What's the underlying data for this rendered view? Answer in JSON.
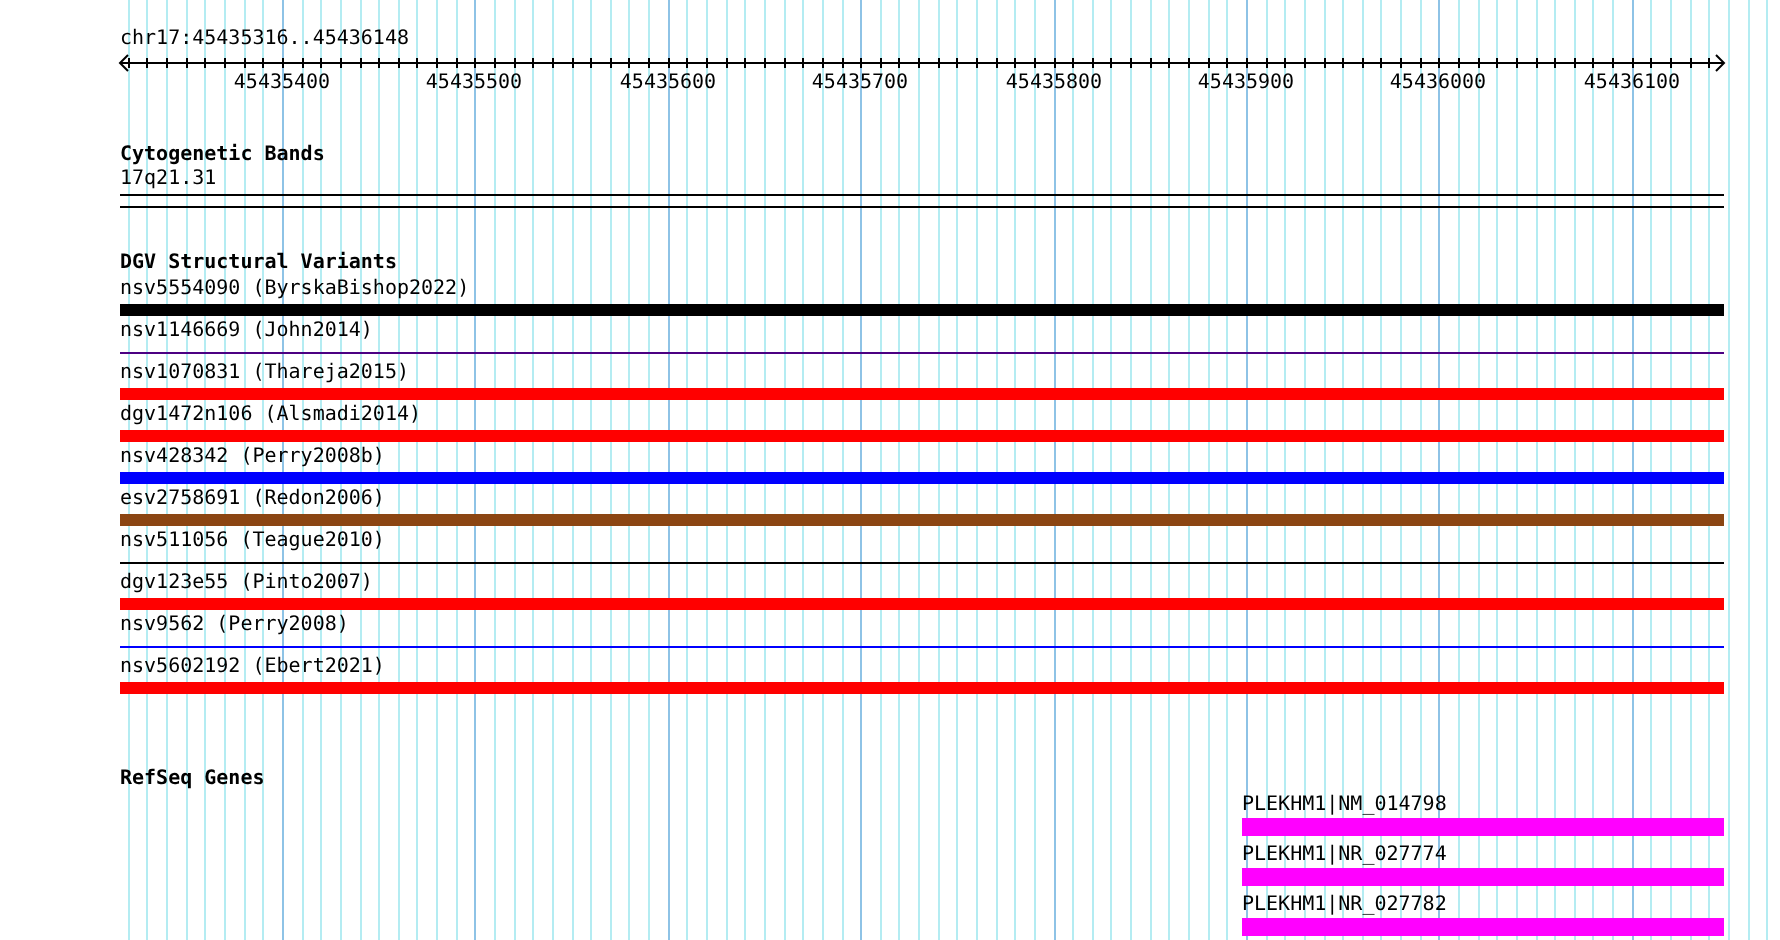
{
  "ruler": {
    "range": "chr17:45435316..45436148",
    "ticks": [
      "45435400",
      "45435500",
      "45435600",
      "45435700",
      "45435800",
      "45435900",
      "45436000",
      "45436100"
    ]
  },
  "cytoband_track": {
    "title": "Cytogenetic Bands",
    "band": "17q21.31"
  },
  "dgv_track": {
    "title": "DGV Structural Variants",
    "variants": [
      {
        "label": "nsv5554090 (ByrskaBishop2022)",
        "kind": "bar",
        "color": "#000000"
      },
      {
        "label": "nsv1146669 (John2014)",
        "kind": "line",
        "color": "#4b0082"
      },
      {
        "label": "nsv1070831 (Thareja2015)",
        "kind": "bar",
        "color": "#ff0000"
      },
      {
        "label": "dgv1472n106 (Alsmadi2014)",
        "kind": "bar",
        "color": "#ff0000"
      },
      {
        "label": "nsv428342 (Perry2008b)",
        "kind": "bar",
        "color": "#0000ff"
      },
      {
        "label": "esv2758691 (Redon2006)",
        "kind": "bar",
        "color": "#8b4513"
      },
      {
        "label": "nsv511056 (Teague2010)",
        "kind": "line",
        "color": "#000000"
      },
      {
        "label": "dgv123e55 (Pinto2007)",
        "kind": "bar",
        "color": "#ff0000"
      },
      {
        "label": "nsv9562 (Perry2008)",
        "kind": "line",
        "color": "#0000ff"
      },
      {
        "label": "nsv5602192 (Ebert2021)",
        "kind": "bar",
        "color": "#ff0000"
      }
    ]
  },
  "refseq_track": {
    "title": "RefSeq Genes",
    "genes": [
      {
        "label": "PLEKHM1|NM_014798"
      },
      {
        "label": "PLEKHM1|NR_027774"
      },
      {
        "label": "PLEKHM1|NR_027782"
      }
    ]
  }
}
